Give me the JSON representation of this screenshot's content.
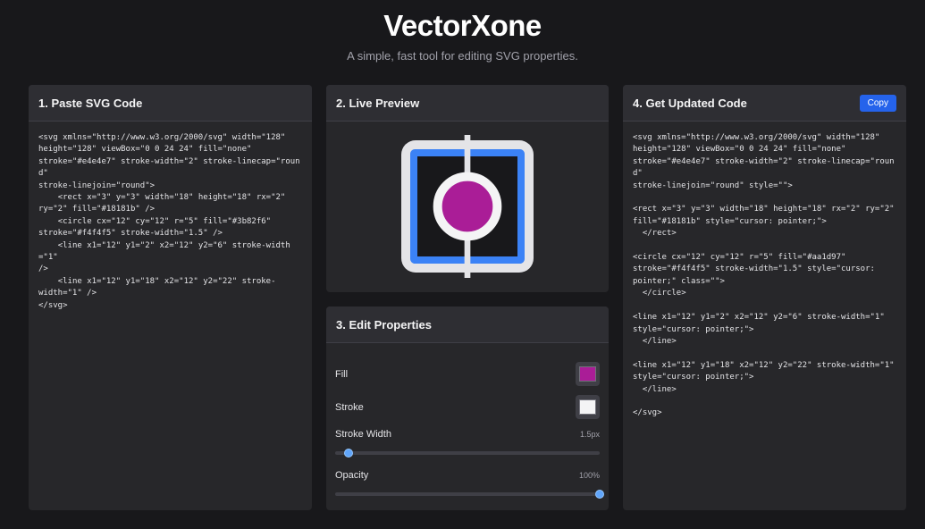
{
  "app": {
    "title": "VectorXone",
    "subtitle": "A simple, fast tool for editing SVG properties."
  },
  "paste_panel": {
    "title": "1. Paste SVG Code",
    "code": "<svg xmlns=\"http://www.w3.org/2000/svg\" width=\"128\"\nheight=\"128\" viewBox=\"0 0 24 24\" fill=\"none\"\nstroke=\"#e4e4e7\" stroke-width=\"2\" stroke-linecap=\"round\"\nstroke-linejoin=\"round\">\n    <rect x=\"3\" y=\"3\" width=\"18\" height=\"18\" rx=\"2\"\nry=\"2\" fill=\"#18181b\" />\n    <circle cx=\"12\" cy=\"12\" r=\"5\" fill=\"#3b82f6\"\nstroke=\"#f4f4f5\" stroke-width=\"1.5\" />\n    <line x1=\"12\" y1=\"2\" x2=\"12\" y2=\"6\" stroke-width=\"1\"\n/>\n    <line x1=\"12\" y1=\"18\" x2=\"12\" y2=\"22\" stroke-\nwidth=\"1\" />\n</svg>"
  },
  "preview_panel": {
    "title": "2. Live Preview",
    "colors": {
      "outer_stroke": "#e4e4e7",
      "rect_fill": "#18181b",
      "rect_border": "#3b82f6",
      "circle_fill": "#aa1d97",
      "circle_stroke": "#f4f4f5"
    }
  },
  "props_panel": {
    "title": "3. Edit Properties",
    "fill_label": "Fill",
    "fill_color": "#aa1d97",
    "stroke_label": "Stroke",
    "stroke_color": "#f4f4f5",
    "stroke_width_label": "Stroke Width",
    "stroke_width_value": "1.5px",
    "stroke_width_fraction": 0.05,
    "opacity_label": "Opacity",
    "opacity_value": "100%",
    "opacity_fraction": 1.0
  },
  "updated_panel": {
    "title": "4. Get Updated Code",
    "copy_label": "Copy",
    "code": "<svg xmlns=\"http://www.w3.org/2000/svg\" width=\"128\"\nheight=\"128\" viewBox=\"0 0 24 24\" fill=\"none\"\nstroke=\"#e4e4e7\" stroke-width=\"2\" stroke-linecap=\"round\"\nstroke-linejoin=\"round\" style=\"\">\n\n<rect x=\"3\" y=\"3\" width=\"18\" height=\"18\" rx=\"2\" ry=\"2\"\nfill=\"#18181b\" style=\"cursor: pointer;\">\n  </rect>\n\n<circle cx=\"12\" cy=\"12\" r=\"5\" fill=\"#aa1d97\"\nstroke=\"#f4f4f5\" stroke-width=\"1.5\" style=\"cursor:\npointer;\" class=\"\">\n  </circle>\n\n<line x1=\"12\" y1=\"2\" x2=\"12\" y2=\"6\" stroke-width=\"1\"\nstyle=\"cursor: pointer;\">\n  </line>\n\n<line x1=\"12\" y1=\"18\" x2=\"12\" y2=\"22\" stroke-width=\"1\"\nstyle=\"cursor: pointer;\">\n  </line>\n\n</svg>"
  }
}
